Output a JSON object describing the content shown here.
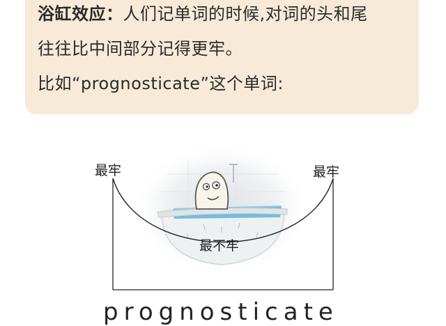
{
  "intro": {
    "term": "浴缸效应：",
    "line1_rest": "人们记单词的时候,对词的头和尾",
    "line2": "往往比中间部分记得更牢。",
    "line3": "比如“prognosticate”这个单词:"
  },
  "diagram": {
    "label_left": "最牢",
    "label_right": "最牢",
    "label_bottom": "最不牢",
    "word": "prognosticate"
  },
  "colors": {
    "card_bg": "#f8ead8",
    "text": "#2b2b2b",
    "water": "#5fb4d8"
  },
  "icons": [
    "bathtub-illustration",
    "smiling-figure-icon"
  ]
}
